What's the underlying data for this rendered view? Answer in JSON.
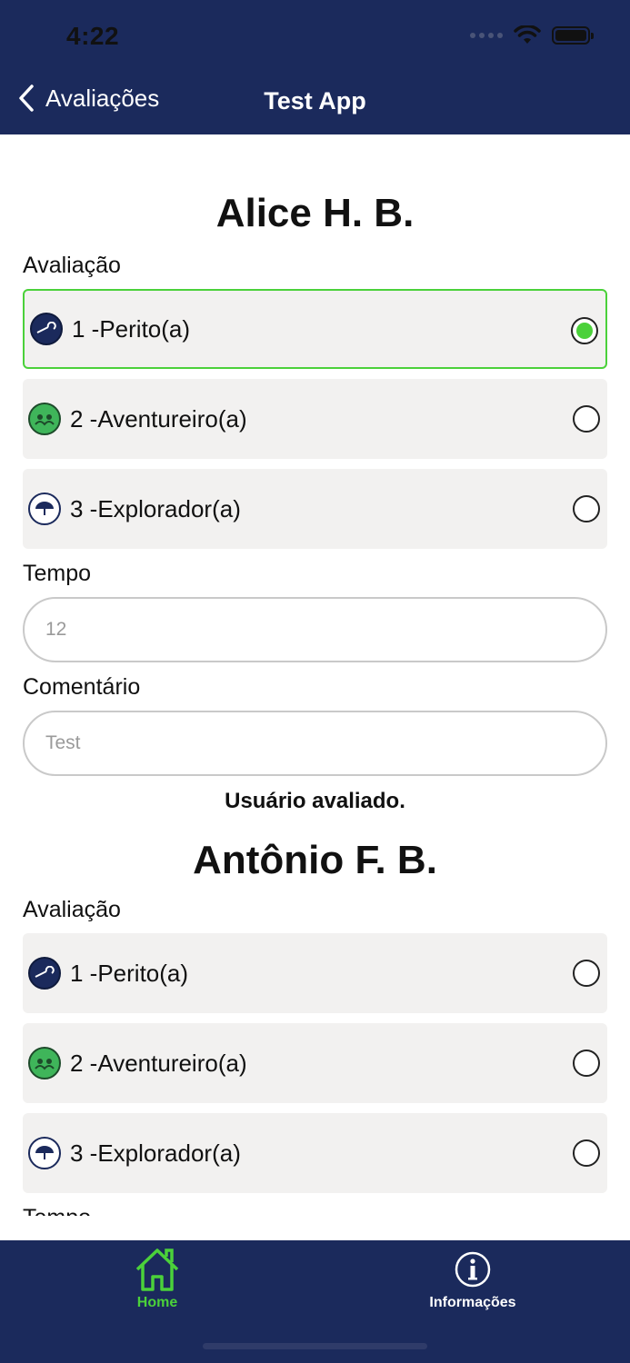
{
  "status_bar": {
    "time": "4:22"
  },
  "nav": {
    "back_label": "Avaliações",
    "title": "Test App"
  },
  "users": [
    {
      "name": "Alice  H. B.",
      "rating_label": "Avaliação",
      "options": [
        {
          "label": "1 -Perito(a)",
          "icon": "wrench-badge-icon",
          "selected": true
        },
        {
          "label": "2 -Aventureiro(a)",
          "icon": "group-badge-icon",
          "selected": false
        },
        {
          "label": "3 -Explorador(a)",
          "icon": "umbrella-badge-icon",
          "selected": false
        }
      ],
      "time_label": "Tempo",
      "time_value": "12",
      "comment_label": "Comentário",
      "comment_value": "Test",
      "status": "Usuário avaliado."
    },
    {
      "name": "Antônio  F. B.",
      "rating_label": "Avaliação",
      "options": [
        {
          "label": "1 -Perito(a)",
          "icon": "wrench-badge-icon",
          "selected": false
        },
        {
          "label": "2 -Aventureiro(a)",
          "icon": "group-badge-icon",
          "selected": false
        },
        {
          "label": "3 -Explorador(a)",
          "icon": "umbrella-badge-icon",
          "selected": false
        }
      ],
      "time_label": "Tempo"
    }
  ],
  "tabbar": {
    "home_label": "Home",
    "info_label": "Informações",
    "active_color": "#4bd13a"
  },
  "colors": {
    "navy": "#1b2a5c",
    "accent_green": "#4bd13a",
    "option_bg": "#f2f1f0"
  }
}
